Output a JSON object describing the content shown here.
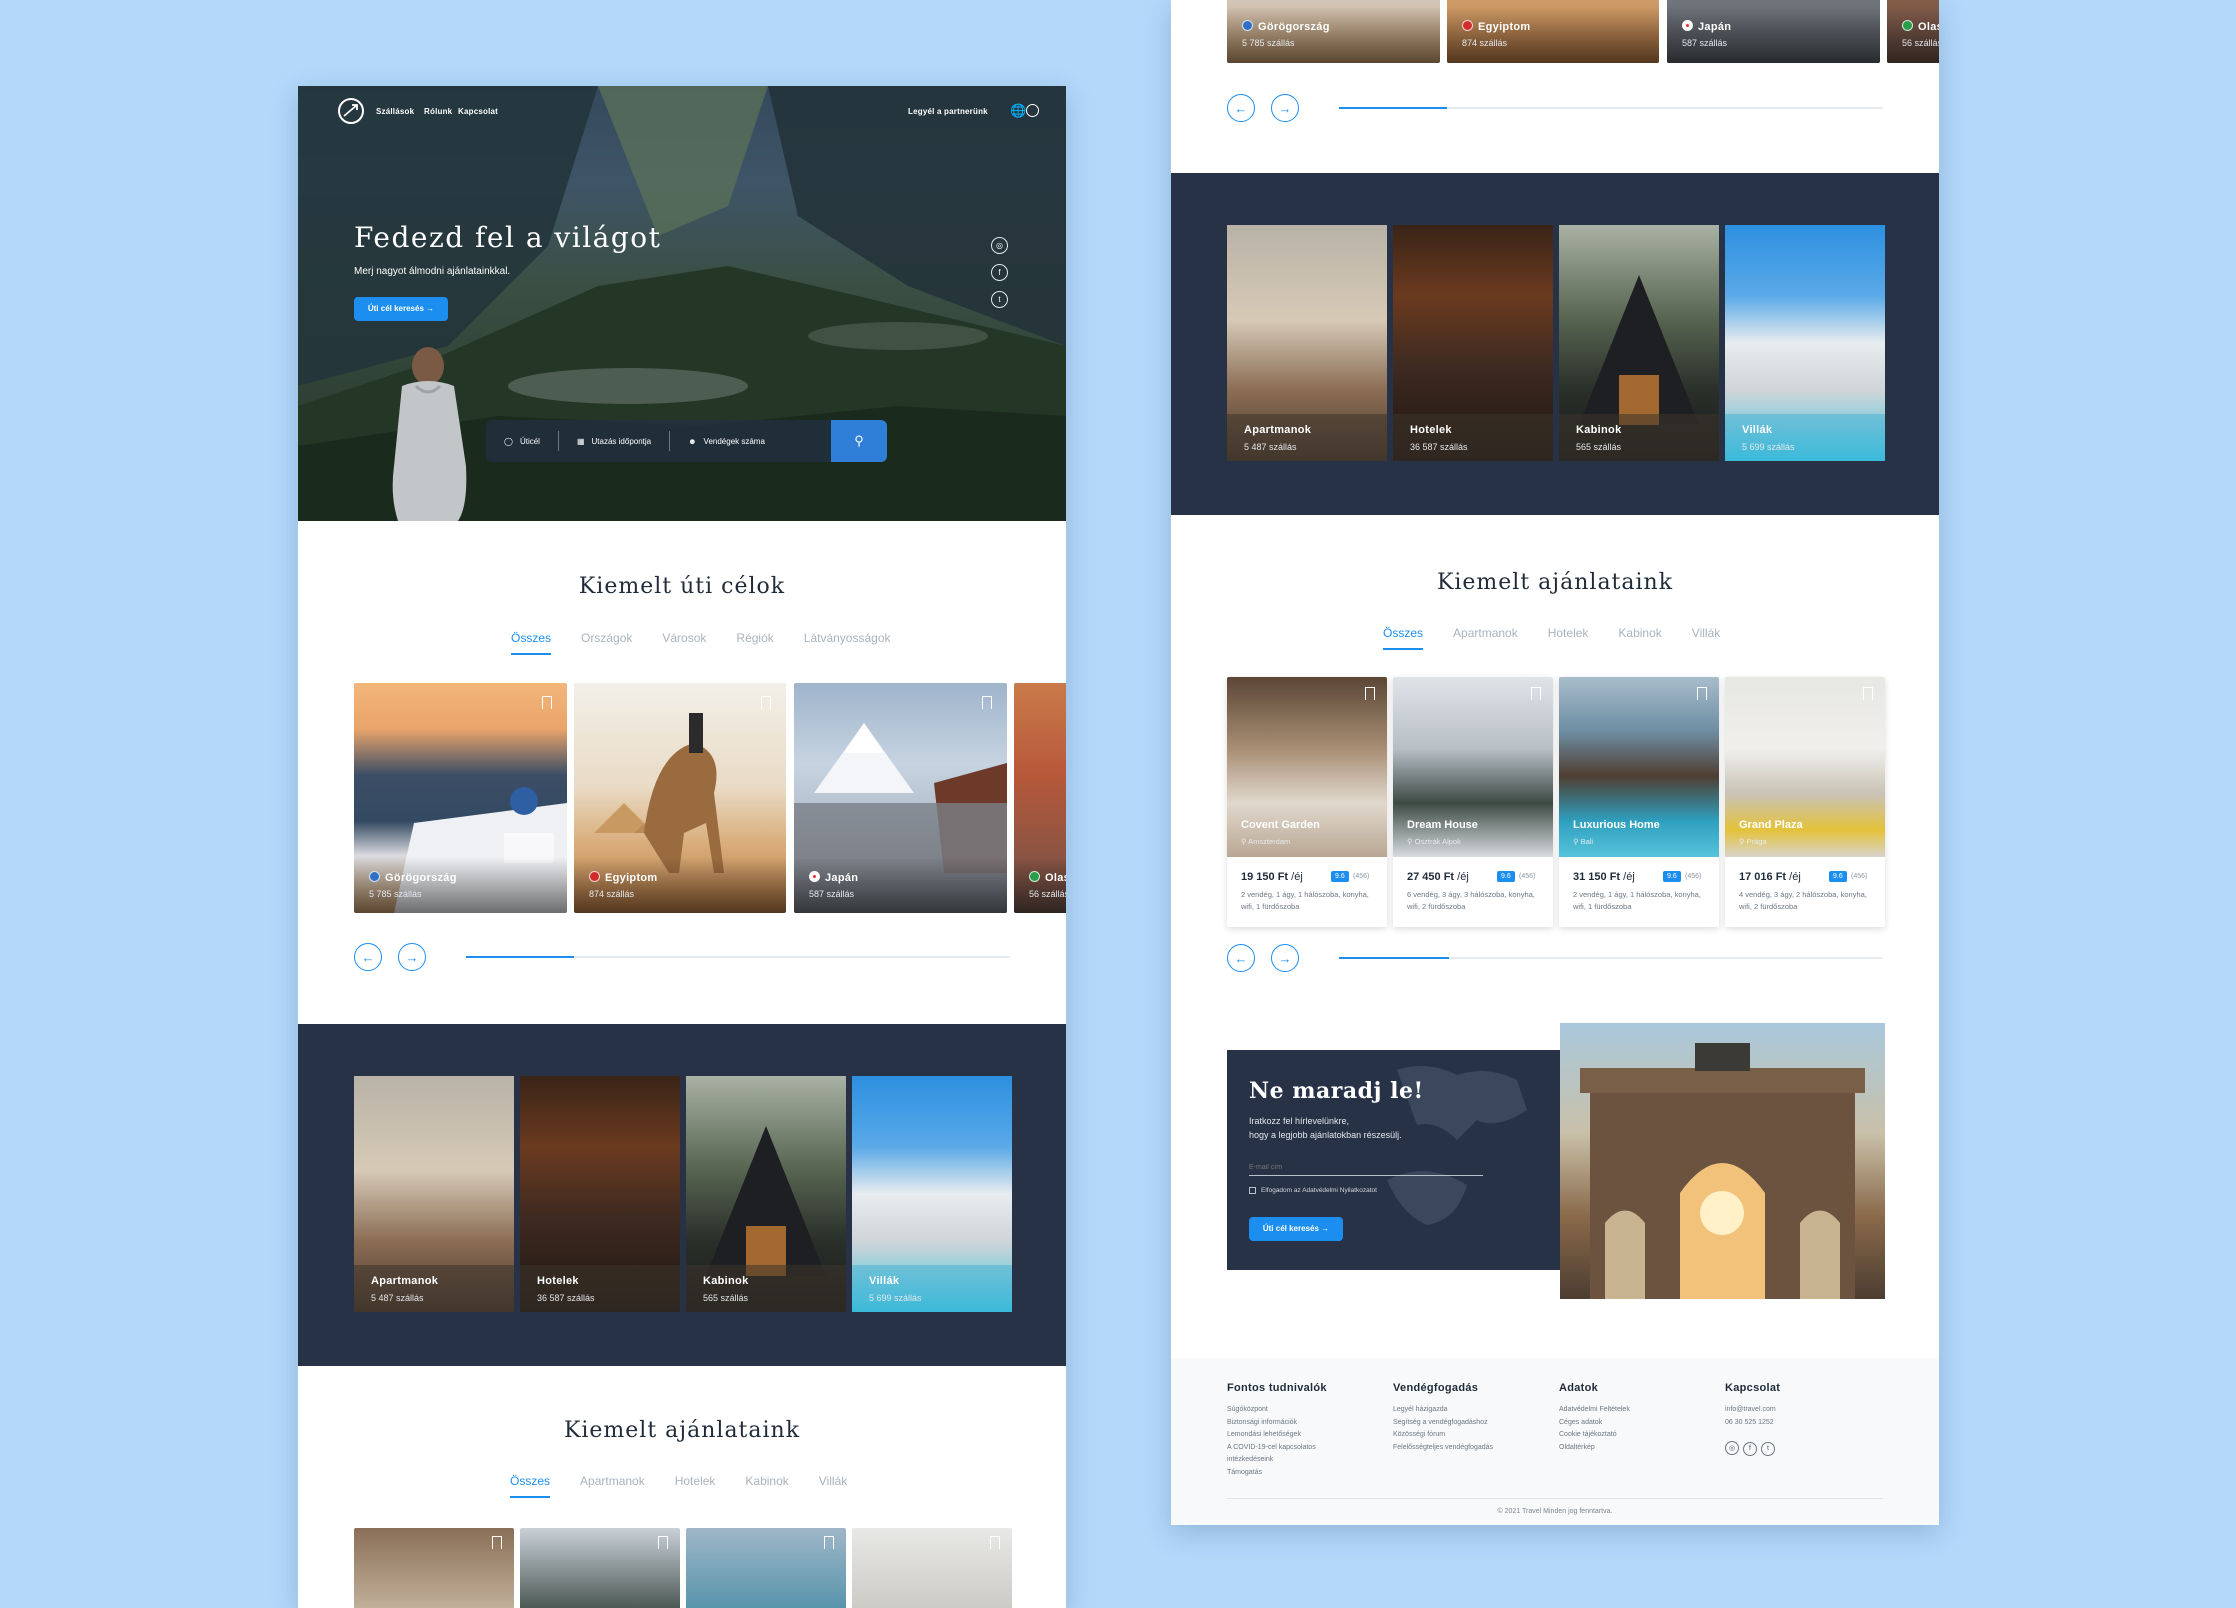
{
  "nav": {
    "links": [
      "Szállások",
      "Rólunk",
      "Kapcsolat"
    ],
    "partner": "Legyél a partnerünk"
  },
  "hero": {
    "title": "Fedezd fel a világot",
    "subtitle": "Merj nagyot álmodni ajánlatainkkal.",
    "button": "Úti cél keresés →",
    "search": {
      "destination": "Úticél",
      "date": "Utazás időpontja",
      "guests": "Vendégek száma"
    }
  },
  "destinations": {
    "title": "Kiemelt úti célok",
    "tabs": [
      "Összes",
      "Országok",
      "Városok",
      "Régiók",
      "Látványosságok"
    ],
    "cards": [
      {
        "name": "Görögország",
        "count": "5 785 szállás",
        "flag": "#2f6fc4"
      },
      {
        "name": "Egyiptom",
        "count": "874 szállás",
        "flag": "#d22b2b"
      },
      {
        "name": "Japán",
        "count": "587 szállás",
        "flag": "#e53030"
      },
      {
        "name": "Olaszország",
        "count": "56 szállás",
        "flag": "#2a9d4a"
      }
    ]
  },
  "categories": [
    {
      "name": "Apartmanok",
      "count": "5 487 szállás"
    },
    {
      "name": "Hotelek",
      "count": "36 587 szállás"
    },
    {
      "name": "Kabinok",
      "count": "565 szállás"
    },
    {
      "name": "Villák",
      "count": "5 699 szállás"
    }
  ],
  "offers": {
    "title": "Kiemelt ajánlataink",
    "tabs": [
      "Összes",
      "Apartmanok",
      "Hotelek",
      "Kabinok",
      "Villák"
    ],
    "items": [
      {
        "name": "Covent Garden",
        "location": "Amszterdam",
        "price": "19 150 Ft",
        "unit": "/éj",
        "score": "9.6",
        "reviews": "(456)",
        "desc": "2 vendég, 1 ágy, 1 hálószoba, konyha, wifi, 1 fürdőszoba"
      },
      {
        "name": "Dream House",
        "location": "Osztrák Alpok",
        "price": "27 450 Ft",
        "unit": "/éj",
        "score": "9.6",
        "reviews": "(456)",
        "desc": "6 vendég, 3 ágy, 3 hálószoba, konyha, wifi, 2 fürdőszoba"
      },
      {
        "name": "Luxurious Home",
        "location": "Bali",
        "price": "31 150 Ft",
        "unit": "/éj",
        "score": "9.6",
        "reviews": "(456)",
        "desc": "2 vendég, 1 ágy, 1 hálószoba, konyha, wifi, 1 fürdőszoba"
      },
      {
        "name": "Grand Plaza",
        "location": "Prága",
        "price": "17 016 Ft",
        "unit": "/éj",
        "score": "9.6",
        "reviews": "(456)",
        "desc": "4 vendég, 3 ágy, 2 hálószoba, konyha, wifi, 2 fürdőszoba"
      }
    ]
  },
  "newsletter": {
    "title": "Ne maradj le!",
    "text1": "Iratkozz fel hírlevelünkre,",
    "text2": "hogy a legjobb ajánlatokban részesülj.",
    "email_placeholder": "E-mail cím",
    "consent": "Elfogadom az Adatvédelmi Nyilatkozatot",
    "button": "Úti cél keresés →"
  },
  "footer": {
    "col1": {
      "title": "Fontos tudnivalók",
      "links": [
        "Súgóközpont",
        "Biztonsági információk",
        "Lemondási lehetőségek",
        "A COVID-19-cel kapcsolatos",
        "intézkedéseink",
        "Támogatás"
      ]
    },
    "col2": {
      "title": "Vendégfogadás",
      "links": [
        "Legyél házigazda",
        "Segítség a vendégfogadáshoz",
        "Közösségi fórum",
        "Felelősségteljes vendégfogadás"
      ]
    },
    "col3": {
      "title": "Adatok",
      "links": [
        "Adatvédelmi Feltételek",
        "Céges adatok",
        "Cookie tájékoztató",
        "Oldaltérkép"
      ]
    },
    "col4": {
      "title": "Kapcsolat",
      "email": "info@travel.com",
      "phone": "06 30 525 1252"
    },
    "copyright": "© 2021 Travel Minden jog fenntartva."
  },
  "colors": {
    "accent": "#1b8ef0",
    "dark": "#273246",
    "background": "#b3d8fa"
  },
  "icons": [
    "globe-icon",
    "user-icon",
    "instagram-icon",
    "facebook-icon",
    "twitter-icon",
    "search-icon",
    "calendar-icon",
    "guests-icon",
    "bookmark-icon",
    "arrow-left-icon",
    "arrow-right-icon",
    "location-pin-icon"
  ]
}
